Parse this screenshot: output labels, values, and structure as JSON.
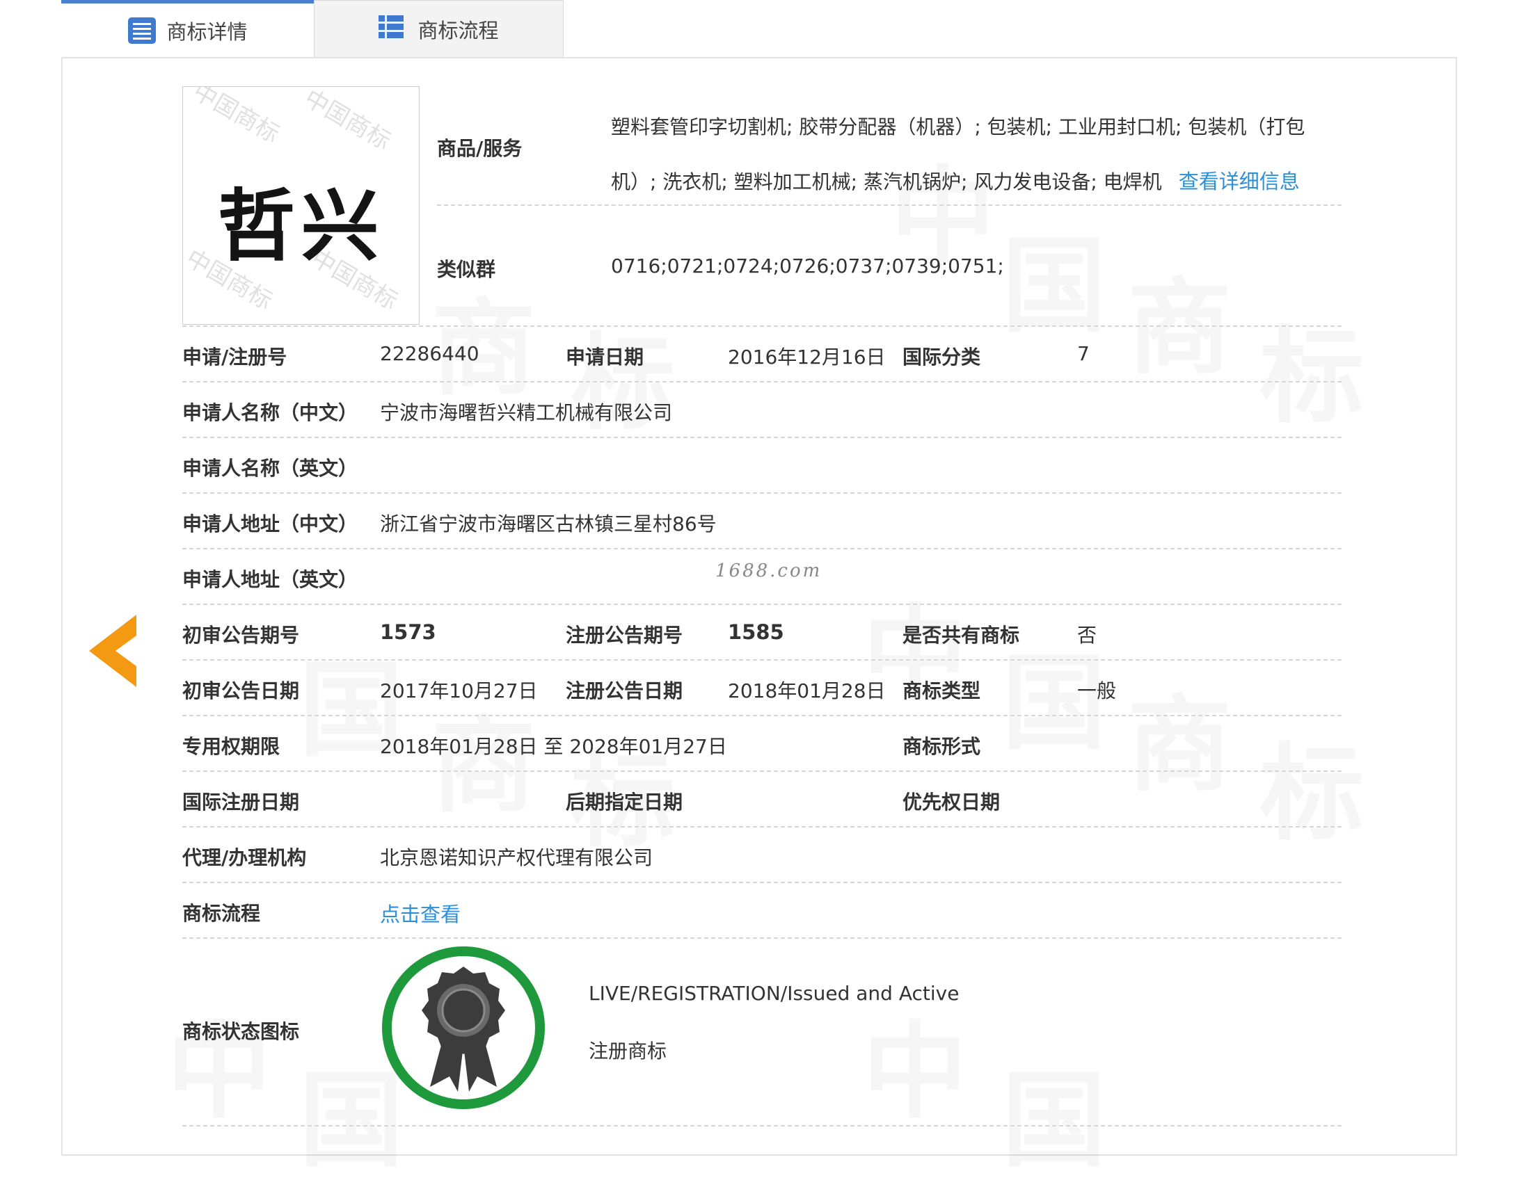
{
  "tabs": {
    "details_label": "商标详情",
    "flow_label": "商标流程"
  },
  "logo": {
    "text": "哲兴",
    "watermark_text": "中国商标"
  },
  "goods": {
    "label": "商品/服务",
    "line1": "塑料套管印字切割机; 胶带分配器（机器）; 包装机; 工业用封口机; 包装机（打包",
    "line2": "机）; 洗衣机; 塑料加工机械; 蒸汽机锅炉; 风力发电设备; 电焊机",
    "detail_link": "查看详细信息"
  },
  "similar_group": {
    "label": "类似群",
    "value": "0716;0721;0724;0726;0737;0739;0751;"
  },
  "rows": {
    "reg_no_label": "申请/注册号",
    "reg_no": "22286440",
    "app_date_label": "申请日期",
    "app_date": "2016年12月16日",
    "intl_class_label": "国际分类",
    "intl_class": "7",
    "applicant_cn_label": "申请人名称（中文）",
    "applicant_cn": "宁波市海曙哲兴精工机械有限公司",
    "applicant_en_label": "申请人名称（英文）",
    "address_cn_label": "申请人地址（中文）",
    "address_cn": "浙江省宁波市海曙区古林镇三星村86号",
    "address_en_label": "申请人地址（英文）",
    "prelim_no_label": "初审公告期号",
    "prelim_no": "1573",
    "reg_pub_no_label": "注册公告期号",
    "reg_pub_no": "1585",
    "shared_label": "是否共有商标",
    "shared": "否",
    "prelim_date_label": "初审公告日期",
    "prelim_date": "2017年10月27日",
    "reg_pub_date_label": "注册公告日期",
    "reg_pub_date": "2018年01月28日",
    "tm_type_label": "商标类型",
    "tm_type": "一般",
    "exclusive_label": "专用权期限",
    "exclusive": "2018年01月28日 至 2028年01月27日",
    "tm_form_label": "商标形式",
    "intl_reg_date_label": "国际注册日期",
    "later_date_label": "后期指定日期",
    "priority_date_label": "优先权日期",
    "agent_label": "代理/办理机构",
    "agent": "北京恩诺知识产权代理有限公司",
    "flow_label": "商标流程",
    "flow_link": "点击查看"
  },
  "status": {
    "label": "商标状态图标",
    "en": "LIVE/REGISTRATION/Issued and Active",
    "cn": "注册商标"
  },
  "site_watermark": "1688.com",
  "colors": {
    "tab_accent": "#4a7fd0",
    "link": "#2c8fd8",
    "arrow": "#f39a12",
    "badge_ring": "#1e9a3c"
  },
  "icons": {
    "details_tab": "list-icon",
    "flow_tab": "grid-list-icon",
    "back": "chevron-left-icon",
    "status": "award-ribbon-icon"
  }
}
